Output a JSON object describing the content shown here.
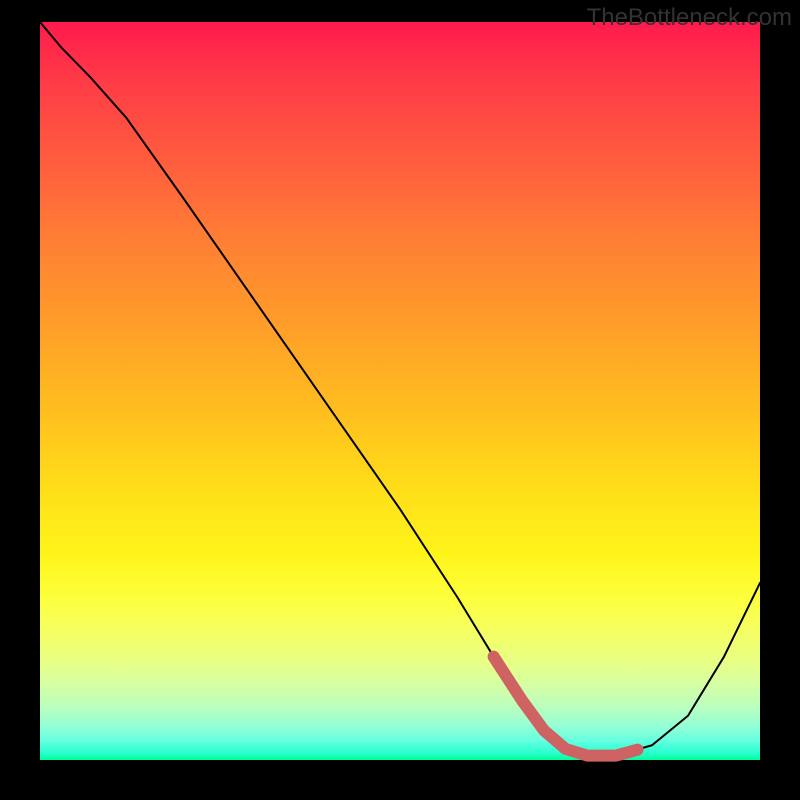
{
  "watermark": "TheBottleneck.com",
  "chart_data": {
    "type": "line",
    "title": "",
    "xlabel": "",
    "ylabel": "",
    "xlim": [
      0,
      100
    ],
    "ylim": [
      0,
      100
    ],
    "series": [
      {
        "name": "curve",
        "x": [
          0,
          3,
          7,
          12,
          20,
          30,
          40,
          50,
          58,
          63,
          67,
          70,
          73,
          76,
          80,
          85,
          90,
          95,
          100
        ],
        "values": [
          100,
          96.5,
          92.5,
          87,
          76,
          62,
          48,
          34,
          22,
          14,
          8,
          4,
          1.5,
          0.6,
          0.6,
          2,
          6,
          14,
          24
        ]
      }
    ],
    "highlight": {
      "x": [
        63,
        67,
        70,
        73,
        76,
        80,
        83
      ],
      "values": [
        14,
        8,
        4,
        1.5,
        0.6,
        0.6,
        1.4
      ]
    },
    "background": "rainbow-vertical-gradient"
  }
}
